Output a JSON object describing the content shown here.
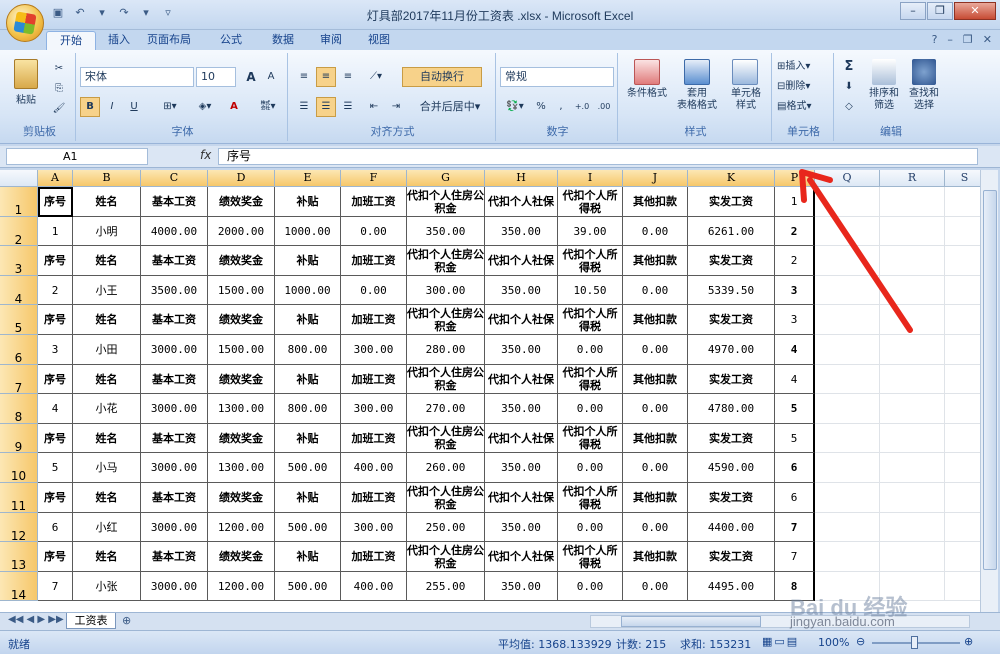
{
  "window": {
    "title": "灯具部2017年11月份工资表 .xlsx - Microsoft Excel"
  },
  "tabs": [
    "开始",
    "插入",
    "页面布局",
    "公式",
    "数据",
    "审阅",
    "视图"
  ],
  "ribbon": {
    "clipboard": {
      "label": "剪贴板",
      "paste": "粘贴"
    },
    "font": {
      "label": "字体",
      "name": "宋体",
      "size": "10",
      "bold": "B",
      "italic": "I",
      "underline": "U",
      "grow": "A",
      "shrink": "A",
      "color": "A"
    },
    "alignment": {
      "label": "对齐方式",
      "wrap": "自动换行",
      "merge": "合并后居中"
    },
    "number": {
      "label": "数字",
      "format": "常规",
      "percent": "%",
      "comma": ","
    },
    "styles": {
      "label": "样式",
      "conditional": "条件格式",
      "table": "套用\n表格格式",
      "cell": "单元格\n样式"
    },
    "cells": {
      "label": "单元格",
      "insert": "插入",
      "delete": "删除",
      "format": "格式"
    },
    "editing": {
      "label": "编辑",
      "sort": "排序和\n筛选",
      "find": "查找和\n选择",
      "sum": "Σ"
    }
  },
  "formula_bar": {
    "name_box": "A1",
    "fx": "fx",
    "content": "序号"
  },
  "columns": [
    "A",
    "B",
    "C",
    "D",
    "E",
    "F",
    "G",
    "H",
    "I",
    "J",
    "K",
    "P",
    "Q",
    "R",
    "S"
  ],
  "rows": [
    "1",
    "2",
    "3",
    "4",
    "5",
    "6",
    "7",
    "8",
    "9",
    "10",
    "11",
    "12",
    "13",
    "14"
  ],
  "header_row": [
    "序号",
    "姓名",
    "基本工资",
    "绩效奖金",
    "补贴",
    "加班工资",
    "代扣个人住房公积金",
    "代扣个人社保",
    "代扣个人所得税",
    "其他扣款",
    "实发工资"
  ],
  "sheet_rows": [
    {
      "type": "h",
      "p": "1"
    },
    {
      "type": "d",
      "p": "2",
      "vals": [
        "1",
        "小明",
        "4000.00",
        "2000.00",
        "1000.00",
        "0.00",
        "350.00",
        "350.00",
        "39.00",
        "0.00",
        "6261.00"
      ]
    },
    {
      "type": "h",
      "p": "2"
    },
    {
      "type": "d",
      "p": "3",
      "vals": [
        "2",
        "小王",
        "3500.00",
        "1500.00",
        "1000.00",
        "0.00",
        "300.00",
        "350.00",
        "10.50",
        "0.00",
        "5339.50"
      ]
    },
    {
      "type": "h",
      "p": "3"
    },
    {
      "type": "d",
      "p": "4",
      "vals": [
        "3",
        "小田",
        "3000.00",
        "1500.00",
        "800.00",
        "300.00",
        "280.00",
        "350.00",
        "0.00",
        "0.00",
        "4970.00"
      ]
    },
    {
      "type": "h",
      "p": "4"
    },
    {
      "type": "d",
      "p": "5",
      "vals": [
        "4",
        "小花",
        "3000.00",
        "1300.00",
        "800.00",
        "300.00",
        "270.00",
        "350.00",
        "0.00",
        "0.00",
        "4780.00"
      ]
    },
    {
      "type": "h",
      "p": "5"
    },
    {
      "type": "d",
      "p": "6",
      "vals": [
        "5",
        "小马",
        "3000.00",
        "1300.00",
        "500.00",
        "400.00",
        "260.00",
        "350.00",
        "0.00",
        "0.00",
        "4590.00"
      ]
    },
    {
      "type": "h",
      "p": "6"
    },
    {
      "type": "d",
      "p": "7",
      "vals": [
        "6",
        "小红",
        "3000.00",
        "1200.00",
        "500.00",
        "300.00",
        "250.00",
        "350.00",
        "0.00",
        "0.00",
        "4400.00"
      ]
    },
    {
      "type": "h",
      "p": "7"
    },
    {
      "type": "d",
      "p": "8",
      "vals": [
        "7",
        "小张",
        "3000.00",
        "1200.00",
        "500.00",
        "400.00",
        "255.00",
        "350.00",
        "0.00",
        "0.00",
        "4495.00"
      ]
    }
  ],
  "sheet_tab": "工资表",
  "status": {
    "ready": "就绪",
    "average": "平均值: 1368.133929",
    "count": "计数: 215",
    "sum": "求和: 153231",
    "zoom": "100%"
  },
  "watermark": {
    "text": "Bai du 经验",
    "url": "jingyan.baidu.com"
  }
}
